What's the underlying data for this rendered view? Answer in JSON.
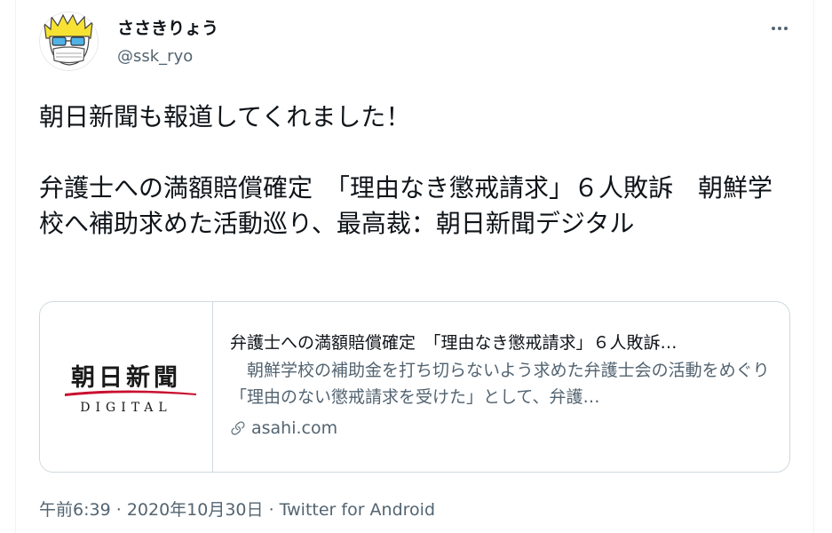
{
  "author": {
    "name": "ささきりょう",
    "handle": "@ssk_ryo"
  },
  "tweet": {
    "text": "朝日新聞も報道してくれました！\n\n弁護士への満額賠償確定　「理由なき懲戒請求」６人敗訴　朝鮮学校へ補助求めた活動巡り、最高裁：朝日新聞デジタル"
  },
  "card": {
    "logo_top": "朝日新聞",
    "logo_bottom": "DIGITAL",
    "title": "弁護士への満額賠償確定　「理由なき懲戒請求」６人敗訴…",
    "description": "　朝鮮学校の補助金を打ち切らないよう求めた弁護士会の活動をめぐり「理由のない懲戒請求を受けた」として、弁護…",
    "domain": "asahi.com",
    "domain_icon": "link-icon"
  },
  "meta": {
    "time": "午前6:39",
    "separator": "·",
    "date": "2020年10月30日",
    "source": "Twitter for Android"
  },
  "colors": {
    "text": "#0f1419",
    "secondary": "#536471",
    "border": "#cfd9de",
    "logo_red": "#c8102e"
  }
}
